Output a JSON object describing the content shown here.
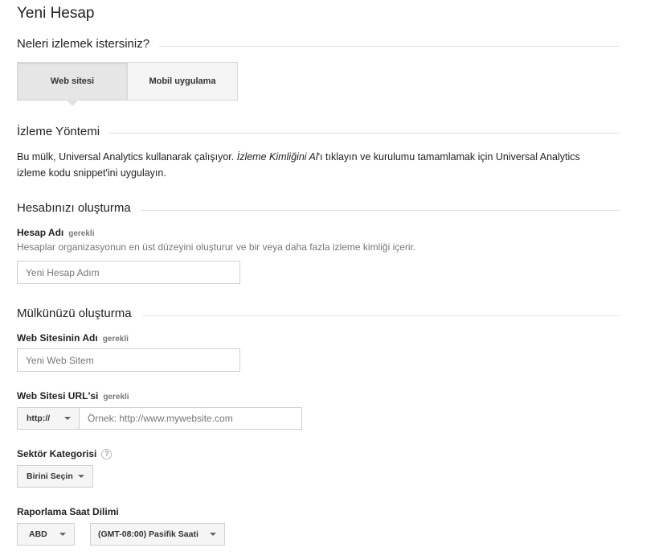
{
  "page_title": "Yeni Hesap",
  "track_section": {
    "heading": "Neleri izlemek istersiniz?",
    "options": [
      {
        "label": "Web sitesi",
        "selected": true
      },
      {
        "label": "Mobil uygulama",
        "selected": false
      }
    ]
  },
  "tracking_method": {
    "heading": "İzleme Yöntemi",
    "text_before": "Bu mülk, Universal Analytics kullanarak çalışıyor. ",
    "text_italic": "İzleme Kimliğini Al",
    "text_after": "'ı tıklayın ve kurulumu tamamlamak için Universal Analytics",
    "text_line2": "izleme kodu snippet'ini uygulayın."
  },
  "account_section": {
    "heading": "Hesabınızı oluşturma",
    "account_name_label": "Hesap Adı",
    "required_label": "gerekli",
    "account_name_help": "Hesaplar organizasyonun en üst düzeyini oluşturur ve bir veya daha fazla izleme kimliği içerir.",
    "account_name_placeholder": "Yeni Hesap Adım"
  },
  "property_section": {
    "heading": "Mülkünüzü oluşturma",
    "site_name_label": "Web Sitesinin Adı",
    "site_name_required": "gerekli",
    "site_name_placeholder": "Yeni Web Sitem",
    "url_label": "Web Sitesi URL'si",
    "url_required": "gerekli",
    "protocol_value": "http://",
    "url_placeholder": "Örnek: http://www.mywebsite.com",
    "industry_label": "Sektör Kategorisi",
    "industry_help_glyph": "?",
    "industry_value": "Birini Seçin",
    "timezone_label": "Raporlama Saat Dilimi",
    "country_value": "ABD",
    "timezone_value": "(GMT-08:00) Pasifik Saati"
  }
}
